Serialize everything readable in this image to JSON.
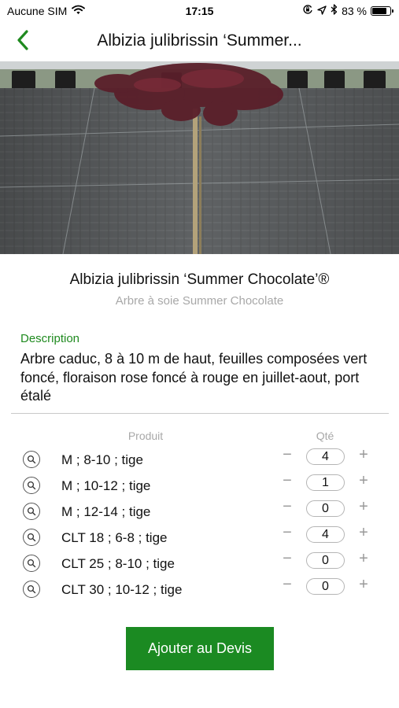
{
  "status_bar": {
    "carrier": "Aucune SIM",
    "time": "17:15",
    "battery_text": "83 %",
    "battery_level": 0.83,
    "icons": [
      "wifi-icon",
      "orientation-lock-icon",
      "location-arrow-icon",
      "bluetooth-icon",
      "battery-icon"
    ]
  },
  "nav": {
    "title": "Albizia julibrissin ‘Summer...",
    "back_icon": "chevron-left-icon",
    "accent_color": "#1f8a1f"
  },
  "plant": {
    "name": "Albizia julibrissin ‘Summer Chocolate’®",
    "common_name": "Arbre à soie Summer Chocolate"
  },
  "description": {
    "label": "Description",
    "text": "Arbre caduc, 8 à 10 m de haut, feuilles composées vert foncé, floraison rose foncé à rouge en juillet-aout, port étalé"
  },
  "table": {
    "product_header": "Produit",
    "qty_header": "Qté",
    "minus_symbol": "−",
    "plus_symbol": "+",
    "rows": [
      {
        "label": "M ; 8-10 ; tige",
        "qty": "4"
      },
      {
        "label": "M ; 10-12 ; tige",
        "qty": "1"
      },
      {
        "label": "M ; 12-14 ; tige",
        "qty": "0"
      },
      {
        "label": "CLT 18 ; 6-8 ; tige",
        "qty": "4"
      },
      {
        "label": "CLT 25 ; 8-10 ; tige",
        "qty": "0"
      },
      {
        "label": "CLT 30 ; 10-12 ; tige",
        "qty": "0"
      }
    ]
  },
  "add_button": {
    "label": "Ajouter au Devis",
    "color": "#1b8a22"
  }
}
